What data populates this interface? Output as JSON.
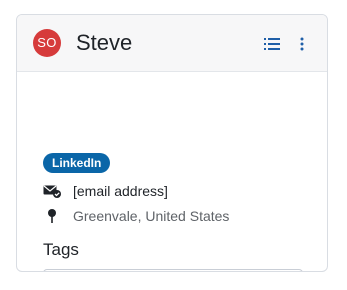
{
  "contact": {
    "initials": "SO",
    "name": "Steve",
    "avatar_color": "#d63b3b",
    "badge": "LinkedIn",
    "email": "[email address]",
    "location": "Greenvale, United States"
  },
  "header_actions": {
    "list_icon": "list-icon",
    "more_icon": "more-vertical-icon"
  },
  "tags": {
    "label": "Tags",
    "placeholder": ""
  },
  "colors": {
    "badge": "#0a66a8",
    "header_background": "#f7f7f8",
    "card_border": "#d9dde3",
    "icon_blue": "#1f5fa8"
  }
}
